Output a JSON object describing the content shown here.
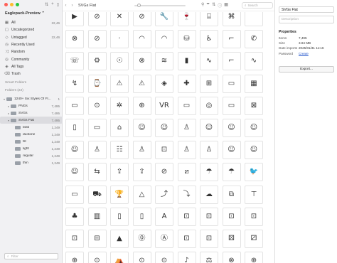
{
  "sidebar": {
    "library_title": "Eaglepack-Preview ⌃",
    "items": [
      {
        "icon": "grid-icon",
        "glyph": "▦",
        "label": "All",
        "count": "22,46"
      },
      {
        "icon": "inbox-icon",
        "glyph": "▢",
        "label": "Uncategorized",
        "count": ""
      },
      {
        "icon": "tag-icon",
        "glyph": "◇",
        "label": "Untagged",
        "count": "22,46"
      },
      {
        "icon": "clock-icon",
        "glyph": "◷",
        "label": "Recently Used",
        "count": ""
      },
      {
        "icon": "shuffle-icon",
        "glyph": "⤨",
        "label": "Random",
        "count": ""
      },
      {
        "icon": "community-icon",
        "glyph": "◎",
        "label": "Community",
        "count": ""
      },
      {
        "icon": "tags-icon",
        "glyph": "◈",
        "label": "All Tags",
        "count": ""
      },
      {
        "icon": "trash-icon",
        "glyph": "⌫",
        "label": "Trash",
        "count": ""
      }
    ],
    "smart_folders_label": "Smart Folders",
    "folders_label": "Folders (22)",
    "folders": [
      {
        "label": "1240+ Six Styles Of Fl...",
        "count": "1",
        "indent": 0,
        "arrow": "▾",
        "selected": false
      },
      {
        "label": "PNGs",
        "count": "7,495",
        "indent": 1,
        "arrow": "▸",
        "selected": false
      },
      {
        "label": "SVGs",
        "count": "7,495",
        "indent": 1,
        "arrow": "▸",
        "selected": false
      },
      {
        "label": "SVGs Flat",
        "count": "7,495",
        "indent": 1,
        "arrow": "▾",
        "selected": true
      },
      {
        "label": "bold",
        "count": "1,249",
        "indent": 2,
        "arrow": "",
        "selected": false
      },
      {
        "label": "duotone",
        "count": "1,249",
        "indent": 2,
        "arrow": "",
        "selected": false
      },
      {
        "label": "fill",
        "count": "1,249",
        "indent": 2,
        "arrow": "",
        "selected": false
      },
      {
        "label": "light",
        "count": "1,249",
        "indent": 2,
        "arrow": "",
        "selected": false
      },
      {
        "label": "regular",
        "count": "1,249",
        "indent": 2,
        "arrow": "",
        "selected": false
      },
      {
        "label": "thin",
        "count": "1,249",
        "indent": 2,
        "arrow": "",
        "selected": false
      }
    ],
    "filter_placeholder": "Filter"
  },
  "toolbar": {
    "title": "SVGs Flat",
    "slider_value": 0.05,
    "search_placeholder": "Search"
  },
  "grid": {
    "columns": 10,
    "rows": [
      [
        "▶",
        "⊘",
        "✕",
        "⊘",
        "🔧",
        "🍷",
        "⌸",
        "⌘",
        "",
        ""
      ],
      [
        "⊗",
        "⊘",
        "·",
        "◠",
        "◠",
        "⛁",
        "♿",
        "⌐",
        "✆",
        ""
      ],
      [
        "☏",
        "⚙",
        "☉",
        "⊗",
        "≋",
        "▮",
        "∿",
        "⌐",
        "∿",
        ""
      ],
      [
        "↯",
        "⌚",
        "⚠",
        "⚠",
        "◈",
        "✚",
        "⊞",
        "▭",
        "▦",
        ""
      ],
      [
        "▭",
        "⊙",
        "✲",
        "⊕",
        "VR",
        "▭",
        "◎",
        "▭",
        "⊠",
        ""
      ],
      [
        "▯",
        "▭",
        "⌂",
        "☺",
        "☺",
        "♙",
        "☺",
        "☺",
        "☺",
        ""
      ],
      [
        "☺",
        "♙",
        "☷",
        "♙",
        "⊡",
        "♙",
        "♙",
        "☺",
        "☺",
        ""
      ],
      [
        "☺",
        "⇆",
        "⇪",
        "⇪",
        "⊘",
        "⧄",
        "☂",
        "☂",
        "🐦",
        ""
      ],
      [
        "▭",
        "⛟",
        "🏆",
        "△",
        "⤴",
        "⤵",
        "☁",
        "⧉",
        "⊤",
        ""
      ],
      [
        "♣",
        "▥",
        "▯",
        "▯",
        "A",
        "⊡",
        "⊡",
        "⊡",
        "⊡",
        ""
      ],
      [
        "⊡",
        "⊟",
        "▲",
        "⓪",
        "Ⓐ",
        "⊡",
        "⊡",
        "⚄",
        "⚂",
        ""
      ],
      [
        "⊕",
        "⊙",
        "⛺",
        "⊙",
        "⊙",
        "♪",
        "⚖",
        "⊗",
        "⊕",
        ""
      ]
    ]
  },
  "inspector": {
    "title_value": "SVGs Flat",
    "description_placeholder": "Description",
    "properties_label": "Properties",
    "props": [
      {
        "key": "Items",
        "value": "7,495",
        "link": false
      },
      {
        "key": "Size",
        "value": "3.84 MB",
        "link": false
      },
      {
        "key": "Date importe",
        "value": "2025/01/31 11:16",
        "link": false
      },
      {
        "key": "Password",
        "value": "Create",
        "link": true
      }
    ],
    "export_label": "Export..."
  }
}
